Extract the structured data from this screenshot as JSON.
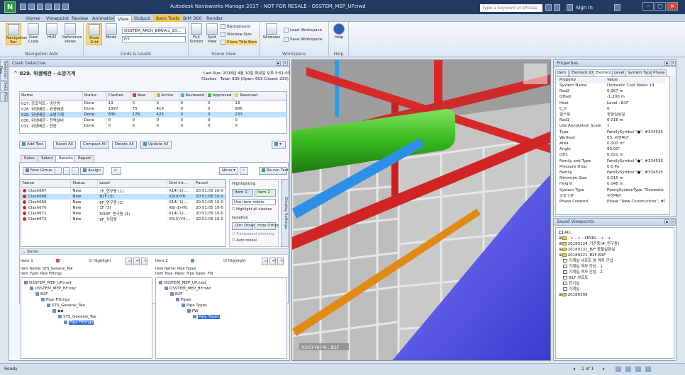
{
  "window": {
    "title": "Autodesk Navisworks Manage 2017 - NOT FOR RESALE - OSSTEM_MEP_UP.nwd",
    "search_placeholder": "Type a keyword or phrase",
    "signin": "Sign In",
    "logo": "N"
  },
  "ribbon_tabs": [
    "Home",
    "Viewpoint",
    "Review",
    "Animation",
    "View",
    "Output",
    "Item Tools",
    "BIM 360",
    "Render"
  ],
  "ribbon": {
    "navigation_aids": {
      "label": "Navigation Aids",
      "buttons": [
        "Navigation Bar",
        "View Cube",
        "HUD",
        "Reference Views"
      ]
    },
    "grids_levels": {
      "label": "Grids & Levels",
      "show_grid": "Show Grid",
      "mode": "Mode",
      "combo1": "OSSTEM_ARCH_BIM(Arc_20...",
      "combo2": "FIT"
    },
    "scene_view": {
      "label": "Scene View",
      "full_screen": "Full Screen",
      "split_view": "Split View",
      "background": "Background",
      "window_size": "Window Size",
      "show_title_bars": "Show Title Bars"
    },
    "workspace": {
      "label": "Workspace",
      "windows": "Windows",
      "load_workspace": "Load Workspace",
      "save_workspace": "Save Workspace"
    },
    "help": {
      "label": "Help",
      "button": "Help"
    }
  },
  "clash": {
    "panel_title": "Clash Detective",
    "test_name": "029. 위생배관 - 소방기계",
    "last_run": "Last Run: 2018년 4월 10일 화요일 오후 5:51:03",
    "clashes_summary": "Clashes - Total: 836 (Open: 603  Closed: 233)",
    "tests_headers": [
      "Name",
      "Status",
      "Clashes",
      "New",
      "Active",
      "Reviewed",
      "Approved",
      "Resolved"
    ],
    "tests_rows": [
      [
        "027. 공조덕트 - 냉난방",
        "Done",
        "13",
        "0",
        "0",
        "0",
        "0",
        "13"
      ],
      [
        "028. 위생배관 - 위생배관",
        "Done",
        "1397",
        "75",
        "416",
        "0",
        "0",
        "906"
      ],
      [
        "029. 위생배관 - 소방기계",
        "Done",
        "836",
        "178",
        "425",
        "0",
        "0",
        "233"
      ],
      [
        "030. 위생배관 - 전력설비",
        "Done",
        "0",
        "0",
        "0",
        "0",
        "0",
        "0"
      ],
      [
        "031. 위생배관 - 전등",
        "Done",
        "0",
        "0",
        "0",
        "0",
        "0",
        "0"
      ]
    ],
    "status_colors": {
      "new": "#e03c2c",
      "active": "#f0a020",
      "reviewed": "#3fb2e8",
      "approved": "#3fba4a",
      "resolved": "#e8d33a"
    },
    "test_buttons": [
      "Add Test",
      "Reset All",
      "Compact All",
      "Delete All",
      "Update All"
    ],
    "subtabs": [
      "Rules",
      "Select",
      "Results",
      "Report"
    ],
    "results_toolbar": {
      "new_group": "New Group",
      "assign": "Assign",
      "none": "None",
      "rerun": "Re-run Test"
    },
    "results_headers": [
      "Name",
      "Status",
      "Level",
      "Grid Int...",
      "Found"
    ],
    "results_rows": [
      [
        "Clash667",
        "New",
        "7F_연구동 (1)",
        "X14(-1)-...",
        "20:51:05 10-0"
      ],
      [
        "Clash668",
        "New",
        "B2F (3)",
        "X2(0)-Y6:",
        "20:51:05 10-0"
      ],
      [
        "Clash669",
        "New",
        "6F_연구동 (2)",
        "X14(-1)-...",
        "20:51:05 10-0"
      ],
      [
        "Clash670",
        "New",
        "1F (3)",
        "X6(-1)-Y6:",
        "20:51:05 10-0"
      ],
      [
        "Clash671",
        "New",
        "ROOF_연구동 (1)",
        "X14(-1)-...",
        "20:51:05 10-0"
      ],
      [
        "Clash672",
        "New",
        "9F_식당동",
        "X5(3)-Y4:...",
        "20:51:05 10-0"
      ]
    ],
    "highlighting": {
      "title": "Highlighting",
      "item1": "Item 1",
      "item2": "Item 2",
      "use_item_colors": "Use item colors",
      "highlight_all": "Highlight all clashes"
    },
    "isolation": {
      "title": "Isolation",
      "dim_other": "Dim Other",
      "hide_other": "Hide Other",
      "transparent": "Transparent dimming",
      "auto_reveal": "Auto reveal"
    },
    "display_settings": "Display Settings",
    "items_label": "Items",
    "item1": {
      "label": "Item 1",
      "highlight": "Highlight",
      "name": "Item Name: STS_General_Tee",
      "type": "Item Type: Pipe Fittings",
      "tree": [
        "OSSTEM_MEP_UP.nwd",
        "OSSTEM_MEP_BF.nwc",
        "B2F",
        "Pipe Fittings",
        "STS_General_Tee",
        "◆◆",
        "STS_General_Tee",
        "Pipe Fittings"
      ]
    },
    "item2": {
      "label": "Item 2",
      "highlight": "Highlight",
      "name": "Item Name: Pipe Types",
      "type": "Item Type: Pipes: Pipe Types: FW",
      "tree": [
        "OSSTEM_MEP_UP.nwd",
        "OSSTEM_MEP_BF.nwc",
        "B2F",
        "Pipes",
        "Pipe Types",
        "FW",
        "Pipe Types"
      ]
    }
  },
  "side_tabs": [
    "Selection Tree",
    "Sets",
    "Find"
  ],
  "viewport": {
    "grid_label": "X2(0)-Y6(-4) : B2F"
  },
  "properties": {
    "title": "Properties",
    "tabs": [
      "Item",
      "Element ID",
      "Element",
      "Level",
      "System Type",
      "Phase"
    ],
    "header": [
      "Property",
      "Value"
    ],
    "rows": [
      [
        "System Name",
        "Domestic Cold Water 14"
      ],
      [
        "Rad2",
        "0.067 m"
      ],
      [
        "Offset",
        "-1,200 m"
      ],
      [
        "Host",
        "Level : B1F"
      ],
      [
        "C_P",
        "0"
      ],
      [
        "설구분",
        "동물실험실"
      ],
      [
        "Rad1",
        "0.016 m"
      ],
      [
        "Use Annotation Scale",
        "1"
      ],
      [
        "Type",
        "FamilySymbol \"●\", #334535"
      ],
      [
        "Workset",
        "03. 위생배관"
      ],
      [
        "Area",
        "0.000 m²"
      ],
      [
        "Angle",
        "90.00°"
      ],
      [
        "OD1",
        "0.021 m"
      ],
      [
        "Family and Type",
        "FamilySymbol \"●\", #334535"
      ],
      [
        "Pressure Drop",
        "0.0 Pa"
      ],
      [
        "Family",
        "FamilySymbol \"●\", #334535"
      ],
      [
        "Minimum Size",
        "0.015 m"
      ],
      [
        "Height",
        "0.048 m"
      ],
      [
        "System Type",
        "PipingSystemType \"Domestic Col"
      ],
      [
        "공종구분",
        "위생배관"
      ],
      [
        "Phase Created",
        "Phase \"New Construction\", #11"
      ]
    ]
  },
  "saved_viewpoints": {
    "title": "Saved Viewpoints",
    "items": [
      "ALL",
      "- + - + - LEVEL - + - + -",
      "20180124_기존동(#_연구동)",
      "20180131_B/F 동물실험실",
      "20180221_B2F-B1F",
      "기계실 샤프트 앞 격자 간섭",
      "기계실 격자 간섭 - 1",
      "기계실 격자 간섭 - 2",
      "B1F 샤프트",
      "전기실",
      "기계실",
      "20180308"
    ]
  },
  "status": {
    "ready": "Ready",
    "page": "1 of 1"
  }
}
